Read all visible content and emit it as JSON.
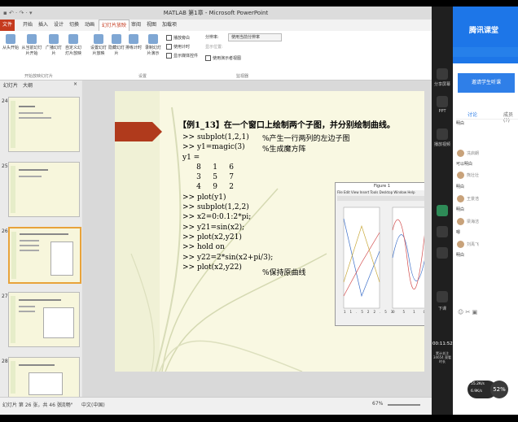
{
  "window": {
    "title": "MATLAB 第1章 - Microsoft PowerPoint",
    "quick_access": "▪ ↶ · ↷ · ▾"
  },
  "menu_tabs": [
    "文件",
    "开始",
    "插入",
    "设计",
    "切换",
    "动画",
    "幻灯片放映",
    "审阅",
    "视图",
    "加载项"
  ],
  "ribbon": {
    "buttons": [
      {
        "label": "从头开始"
      },
      {
        "label": "从当前幻灯片开始"
      },
      {
        "label": "广播幻灯片"
      },
      {
        "label": "自定义幻灯片放映"
      },
      {
        "label": "设置幻灯片放映"
      },
      {
        "label": "隐藏幻灯片"
      },
      {
        "label": "排练计时"
      },
      {
        "label": "录制幻灯片演示"
      }
    ],
    "checkboxes": [
      "播放旁白",
      "使用计时",
      "显示媒体控件"
    ],
    "resolution_label": "分辨率:",
    "resolution_value": "使用当前分辨率",
    "show_on_label": "显示位置:",
    "presenter_view": "使用演示者视图",
    "groups": [
      "开始放映幻灯片",
      "设置",
      "监视器"
    ]
  },
  "pane": {
    "tabs": [
      "幻灯片",
      "大纲"
    ],
    "slide_numbers": [
      "24",
      "25",
      "26",
      "27",
      "28"
    ],
    "close": "×"
  },
  "slide": {
    "title": "【例1_13】在一个窗口上绘制两个子图，并分别绘制曲线。",
    "code_lines": [
      ">> subplot(1,2,1)",
      ">> y1=magic(3)",
      "y1 =",
      "      8     1     6",
      "      3     5     7",
      "      4     9     2",
      ">> plot(y1)",
      ">> subplot(1,2,2)",
      ">> x2=0:0.1:2*pi;",
      ">> y21=sin(x2);",
      ">> plot(x2,y21)",
      ">> hold on",
      ">> y22=2*sin(x2+pi/3);",
      ">> plot(x2,y22)"
    ],
    "comments": [
      "%产生一行两列的左边子图",
      "%生成魔方阵",
      "%保持原曲线"
    ],
    "figure": {
      "title": "Figure 1",
      "menu": "File  Edit  View  Insert  Tools  Desktop  Window  Help",
      "left_xticks": [
        "1",
        "1.5",
        "2",
        "2.5",
        "3"
      ],
      "right_xticks": [
        "0",
        "5",
        "10"
      ],
      "right_yticks": [
        "2",
        "1",
        "0",
        "-1",
        "-2"
      ],
      "left_yticks": [
        "9",
        "8",
        "7",
        "6",
        "5",
        "4",
        "3",
        "2",
        "1"
      ]
    }
  },
  "statusbar": {
    "slide_count": "幻灯片 第 26 张，共 46 张",
    "theme": "\"流畅\"",
    "language": "中文(中国)",
    "zoom": "67%"
  },
  "qq": {
    "logo": "腾讯课堂",
    "share_button": "邀请学生听课",
    "tabs": [
      "讨论",
      "成员(?)"
    ],
    "side": [
      "分享屏幕",
      "PPT",
      "播放视频",
      "下课"
    ],
    "timer": "00:11:52",
    "timer_sub": "累计关注 34654 观看时长",
    "messages": [
      {
        "name": "刘禹飞",
        "text": "明白"
      },
      {
        "name": "冼启朗",
        "text": "可以明白"
      },
      {
        "name": "熊壮壮",
        "text": "明白"
      },
      {
        "name": "王景浩",
        "text": "明白"
      },
      {
        "name": "梁海洁",
        "text": "嗯"
      },
      {
        "name": "刘禹飞",
        "text": "明白"
      }
    ],
    "net_up": "55.2K/s",
    "net_down": "6.9K/s",
    "cpu": "52%"
  },
  "colors": {
    "accent_red": "#c0391b",
    "qq_blue": "#1d76e8",
    "slide_bg": "#f9f8e2"
  }
}
